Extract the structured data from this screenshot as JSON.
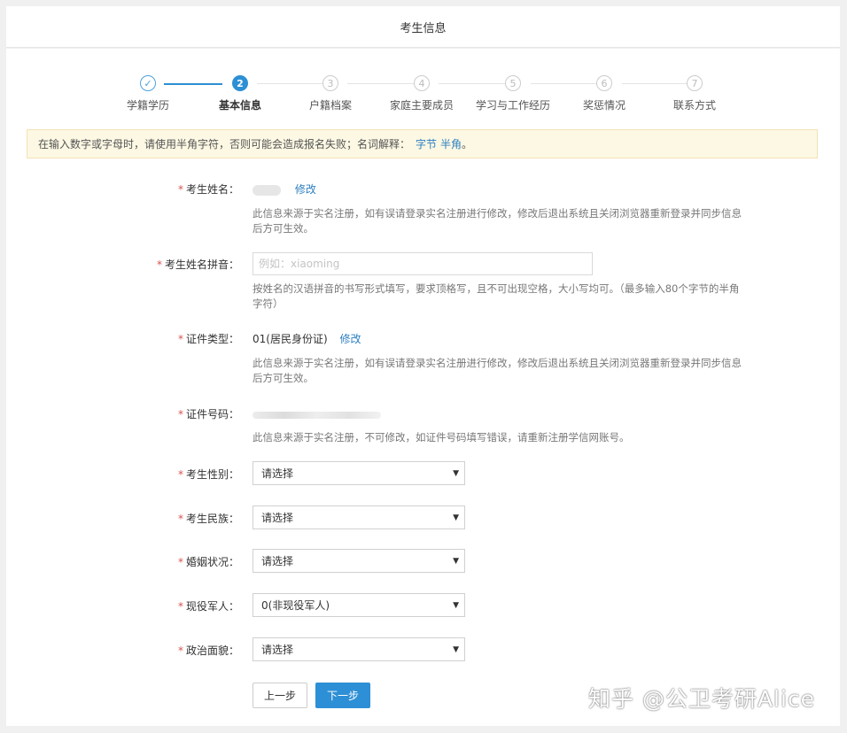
{
  "header": {
    "title": "考生信息"
  },
  "steps": [
    {
      "label": "学籍学历",
      "num": "✓",
      "state": "done"
    },
    {
      "label": "基本信息",
      "num": "2",
      "state": "active"
    },
    {
      "label": "户籍档案",
      "num": "3",
      "state": "todo"
    },
    {
      "label": "家庭主要成员",
      "num": "4",
      "state": "todo"
    },
    {
      "label": "学习与工作经历",
      "num": "5",
      "state": "todo"
    },
    {
      "label": "奖惩情况",
      "num": "6",
      "state": "todo"
    },
    {
      "label": "联系方式",
      "num": "7",
      "state": "todo"
    }
  ],
  "notice": {
    "text": "在输入数字或字母时，请使用半角字符，否则可能会造成报名失败；名词解释：",
    "link1": "字节",
    "link2": "半角",
    "end": "。"
  },
  "form": {
    "required_mark": "*",
    "name": {
      "label": "考生姓名：",
      "edit": "修改",
      "hint": "此信息来源于实名注册，如有误请登录实名注册进行修改，修改后退出系统且关闭浏览器重新登录并同步信息后方可生效。"
    },
    "pinyin": {
      "label": "考生姓名拼音：",
      "placeholder": "例如：xiaoming",
      "hint": "按姓名的汉语拼音的书写形式填写，要求顶格写，且不可出现空格，大小写均可。（最多输入80个字节的半角字符）"
    },
    "id_type": {
      "label": "证件类型：",
      "value": "01(居民身份证)",
      "edit": "修改",
      "hint": "此信息来源于实名注册，如有误请登录实名注册进行修改，修改后退出系统且关闭浏览器重新登录并同步信息后方可生效。"
    },
    "id_number": {
      "label": "证件号码：",
      "hint": "此信息来源于实名注册，不可修改，如证件号码填写错误，请重新注册学信网账号。"
    },
    "gender": {
      "label": "考生性别：",
      "value": "请选择"
    },
    "ethnicity": {
      "label": "考生民族：",
      "value": "请选择"
    },
    "marital": {
      "label": "婚姻状况：",
      "value": "请选择"
    },
    "military": {
      "label": "现役军人：",
      "value": "0(非现役军人)"
    },
    "political": {
      "label": "政治面貌：",
      "value": "请选择"
    }
  },
  "buttons": {
    "prev": "上一步",
    "next": "下一步"
  },
  "watermark": "知乎 @公卫考研Alice",
  "colors": {
    "accent": "#2d8fd5",
    "required": "#d9534f",
    "notice_bg": "#fcf8e3"
  }
}
